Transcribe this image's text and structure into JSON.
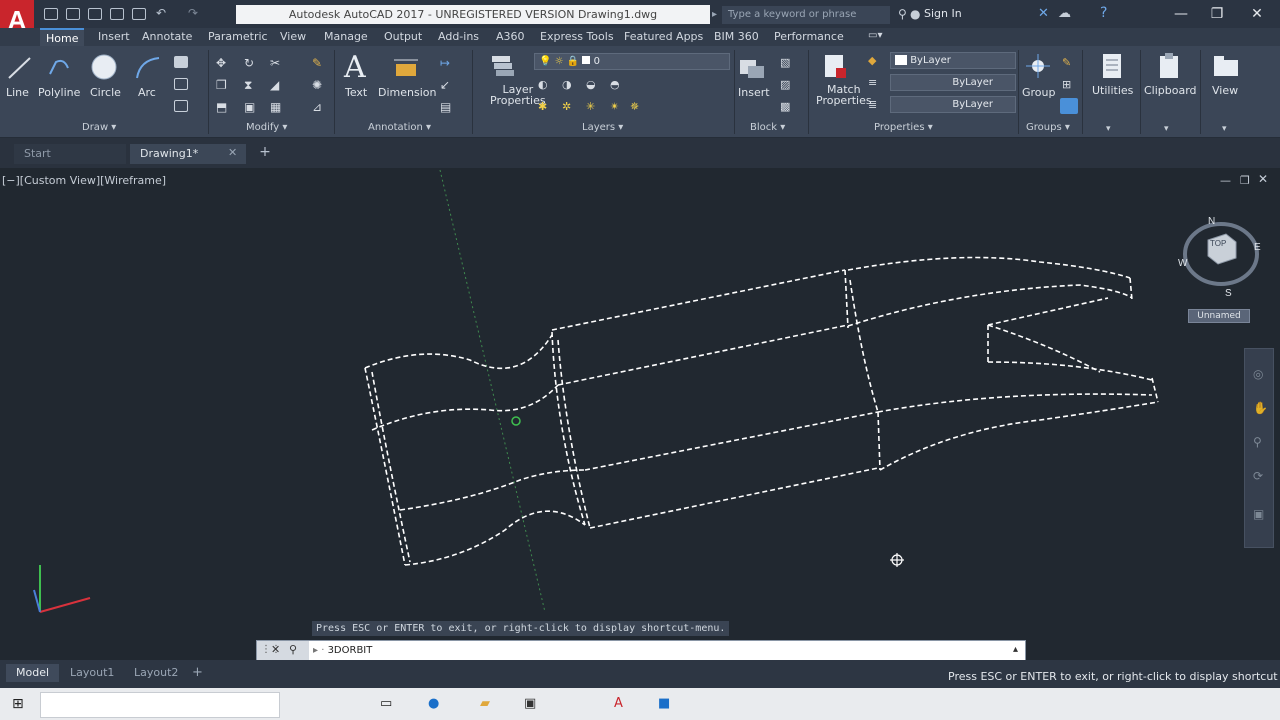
{
  "app": {
    "logo_letter": "A",
    "title": "Autodesk AutoCAD 2017 - UNREGISTERED VERSION   Drawing1.dwg",
    "search_placeholder": "Type a keyword or phrase",
    "signin_label": "Sign In"
  },
  "ribbon_tabs": [
    {
      "label": "Home",
      "active": true
    },
    {
      "label": "Insert"
    },
    {
      "label": "Annotate"
    },
    {
      "label": "Parametric"
    },
    {
      "label": "View"
    },
    {
      "label": "Manage"
    },
    {
      "label": "Output"
    },
    {
      "label": "Add-ins"
    },
    {
      "label": "A360"
    },
    {
      "label": "Express Tools"
    },
    {
      "label": "Featured Apps"
    },
    {
      "label": "BIM 360"
    },
    {
      "label": "Performance"
    }
  ],
  "ribbon": {
    "draw": {
      "line": "Line",
      "polyline": "Polyline",
      "circle": "Circle",
      "arc": "Arc",
      "panel": "Draw ▾"
    },
    "modify": {
      "panel": "Modify ▾"
    },
    "annotation": {
      "text": "Text",
      "dimension": "Dimension",
      "panel": "Annotation ▾"
    },
    "layers": {
      "layer_properties_1": "Layer",
      "layer_properties_2": "Properties",
      "layer_value": "0",
      "panel": "Layers ▾"
    },
    "block": {
      "insert": "Insert",
      "panel": "Block ▾"
    },
    "properties": {
      "match_1": "Match",
      "match_2": "Properties",
      "color": "ByLayer",
      "linetype": "ByLayer",
      "lineweight": "ByLayer",
      "panel": "Properties ▾"
    },
    "groups": {
      "group": "Group",
      "panel": "Groups ▾"
    },
    "utilities": "Utilities",
    "clipboard": "Clipboard",
    "view": "View"
  },
  "file_tabs": [
    {
      "label": "Start"
    },
    {
      "label": "Drawing1*",
      "active": true
    }
  ],
  "viewport": {
    "label": "[−][Custom View][Wireframe]",
    "viewcube": {
      "top": "TOP",
      "n": "N",
      "s": "S",
      "e": "E",
      "w": "W",
      "ucs": "Unnamed"
    }
  },
  "command": {
    "message": "Press ESC or ENTER to exit, or right-click to display shortcut-menu.",
    "input": "3DORBIT"
  },
  "layout_tabs": [
    {
      "label": "Model",
      "active": true
    },
    {
      "label": "Layout1"
    },
    {
      "label": "Layout2"
    }
  ],
  "status_message": "Press ESC or ENTER to exit, or right-click to display shortcut menu.",
  "colors": {
    "accent": "#4a90d9",
    "logo": "#c9252c",
    "canvas": "#212830",
    "wire": "#ffffff"
  }
}
